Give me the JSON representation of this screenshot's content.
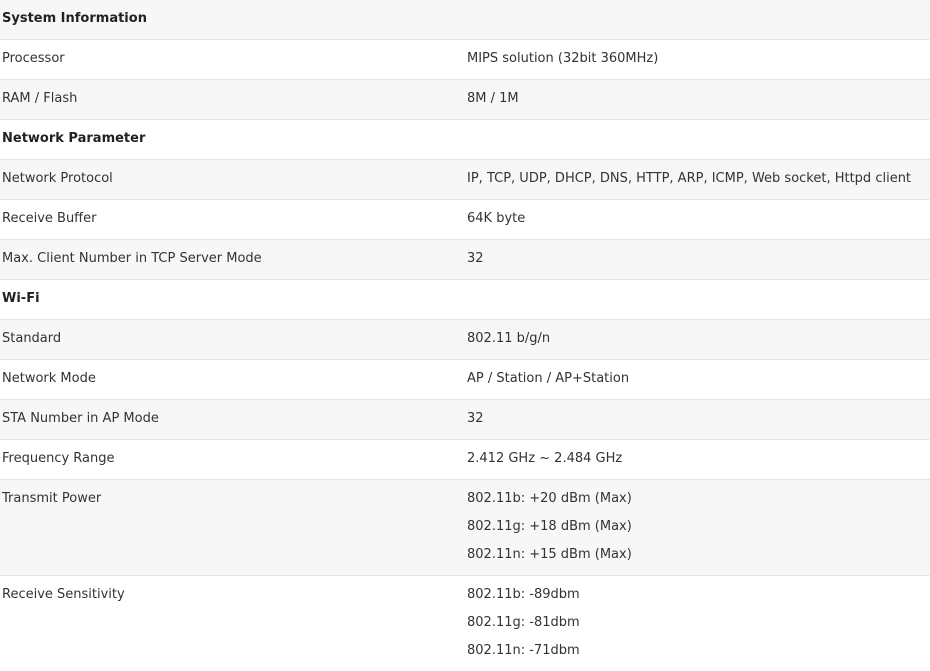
{
  "rows": [
    {
      "type": "section",
      "title": "System Information"
    },
    {
      "type": "item",
      "label": "Processor",
      "values": [
        "MIPS solution (32bit 360MHz)"
      ]
    },
    {
      "type": "item",
      "label": "RAM / Flash",
      "values": [
        "8M / 1M"
      ]
    },
    {
      "type": "section",
      "title": "Network Parameter"
    },
    {
      "type": "item",
      "label": "Network Protocol",
      "values": [
        "IP, TCP, UDP, DHCP, DNS, HTTP, ARP, ICMP, Web socket, Httpd client"
      ]
    },
    {
      "type": "item",
      "label": "Receive Buffer",
      "values": [
        "64K byte"
      ]
    },
    {
      "type": "item",
      "label": "Max. Client Number in TCP Server Mode",
      "values": [
        "32"
      ]
    },
    {
      "type": "section",
      "title": "Wi-Fi"
    },
    {
      "type": "item",
      "label": "Standard",
      "values": [
        "802.11 b/g/n"
      ]
    },
    {
      "type": "item",
      "label": "Network Mode",
      "values": [
        "AP / Station / AP+Station"
      ]
    },
    {
      "type": "item",
      "label": "STA Number in AP Mode",
      "values": [
        "32"
      ]
    },
    {
      "type": "item",
      "label": "Frequency Range",
      "values": [
        "2.412 GHz ~ 2.484 GHz"
      ]
    },
    {
      "type": "item",
      "label": "Transmit Power",
      "values": [
        "802.11b: +20 dBm (Max)",
        "802.11g: +18 dBm (Max)",
        "802.11n: +15 dBm (Max)"
      ]
    },
    {
      "type": "item",
      "label": "Receive Sensitivity",
      "values": [
        "802.11b: -89dbm",
        "802.11g: -81dbm",
        "802.11n: -71dbm"
      ]
    }
  ],
  "colors": {
    "row_shade": "#f7f7f7",
    "row_border": "#e6e6e6",
    "text": "#333333"
  }
}
